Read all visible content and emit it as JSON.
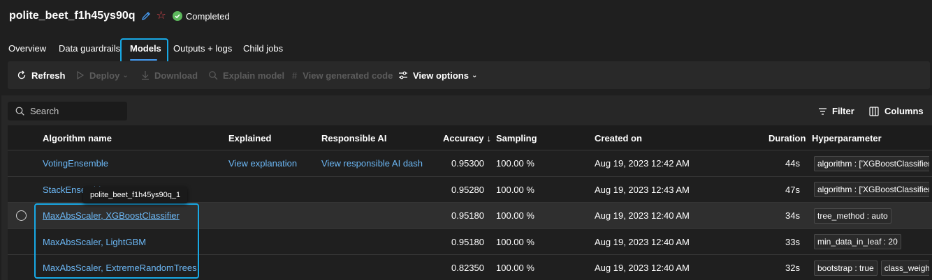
{
  "header": {
    "title": "polite_beet_f1h45ys90q",
    "status": "Completed"
  },
  "tabs": [
    {
      "label": "Overview"
    },
    {
      "label": "Data guardrails"
    },
    {
      "label": "Models",
      "active": true
    },
    {
      "label": "Outputs + logs"
    },
    {
      "label": "Child jobs"
    }
  ],
  "toolbar": {
    "refresh": "Refresh",
    "deploy": "Deploy",
    "download": "Download",
    "explain": "Explain model",
    "view_code": "View generated code",
    "view_options": "View options"
  },
  "search": {
    "placeholder": "Search"
  },
  "filter_label": "Filter",
  "columns_label": "Columns",
  "table": {
    "headers": {
      "algorithm": "Algorithm name",
      "explained": "Explained",
      "responsible": "Responsible AI",
      "accuracy": "Accuracy",
      "accuracy_sort": "↓",
      "sampling": "Sampling",
      "created": "Created on",
      "duration": "Duration",
      "hyperparameter": "Hyperparameter"
    },
    "rows": [
      {
        "algorithm": "VotingEnsemble",
        "explained": "View explanation",
        "responsible": "View responsible AI dash",
        "accuracy": "0.95300",
        "sampling": "100.00 %",
        "created": "Aug 19, 2023 12:42 AM",
        "duration": "44s",
        "hp": [
          "algorithm : ['XGBoostClassifier', '"
        ]
      },
      {
        "algorithm": "StackEnsembl",
        "explained": "",
        "responsible": "",
        "accuracy": "0.95280",
        "sampling": "100.00 %",
        "created": "Aug 19, 2023 12:43 AM",
        "duration": "47s",
        "hp": [
          "algorithm : ['XGBoostClassifier', '"
        ]
      },
      {
        "algorithm": "MaxAbsScaler, XGBoostClassifier",
        "explained": "",
        "responsible": "",
        "accuracy": "0.95180",
        "sampling": "100.00 %",
        "created": "Aug 19, 2023 12:40 AM",
        "duration": "34s",
        "hp": [
          "tree_method : auto"
        ]
      },
      {
        "algorithm": "MaxAbsScaler, LightGBM",
        "explained": "",
        "responsible": "",
        "accuracy": "0.95180",
        "sampling": "100.00 %",
        "created": "Aug 19, 2023 12:40 AM",
        "duration": "33s",
        "hp": [
          "min_data_in_leaf : 20"
        ]
      },
      {
        "algorithm": "MaxAbsScaler, ExtremeRandomTrees",
        "explained": "",
        "responsible": "",
        "accuracy": "0.82350",
        "sampling": "100.00 %",
        "created": "Aug 19, 2023 12:40 AM",
        "duration": "32s",
        "hp": [
          "bootstrap : true",
          "class_weight :"
        ]
      }
    ]
  },
  "tooltip": "polite_beet_f1h45ys90q_1",
  "colors": {
    "accent": "#479ef5",
    "link": "#6cb8f6",
    "highlight": "#18a9e6",
    "status_ok": "#5cb85c",
    "star": "#e0484e"
  }
}
